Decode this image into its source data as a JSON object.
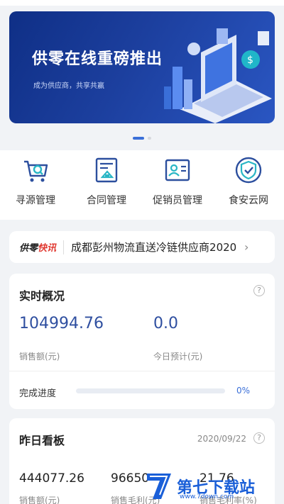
{
  "banner": {
    "title": "供零在线重磅推出",
    "subtitle": "成为供应商，共享共赢"
  },
  "quick_actions": [
    {
      "label": "寻源管理",
      "icon": "cart-search-icon"
    },
    {
      "label": "合同管理",
      "icon": "contract-icon"
    },
    {
      "label": "促销员管理",
      "icon": "id-card-icon"
    },
    {
      "label": "食安云网",
      "icon": "shield-check-icon"
    }
  ],
  "news": {
    "logo_prefix": "供零",
    "logo_suffix": "快讯",
    "text": "成都彭州物流直送冷链供应商2020",
    "arrow": "›"
  },
  "realtime": {
    "title": "实时概况",
    "help": "?",
    "sales_value": "104994.76",
    "sales_label": "销售额(元)",
    "forecast_value": "0.0",
    "forecast_label": "今日预计(元)",
    "progress_label": "完成进度",
    "progress_percent": 0,
    "progress_text": "0%"
  },
  "yesterday": {
    "title": "昨日看板",
    "date": "2020/09/22",
    "help": "?",
    "items": [
      {
        "value": "444077.26",
        "label": "销售额(元)"
      },
      {
        "value": "96650",
        "label": "销售毛利(元)"
      },
      {
        "value": "21.76",
        "label": "销售毛利率(%)"
      }
    ]
  },
  "watermark": {
    "text": "第七下载站",
    "url": "www.7down.com"
  },
  "colors": {
    "accent": "#3a6fd8",
    "number_blue": "#2f4fa0",
    "news_red": "#e03a32"
  }
}
